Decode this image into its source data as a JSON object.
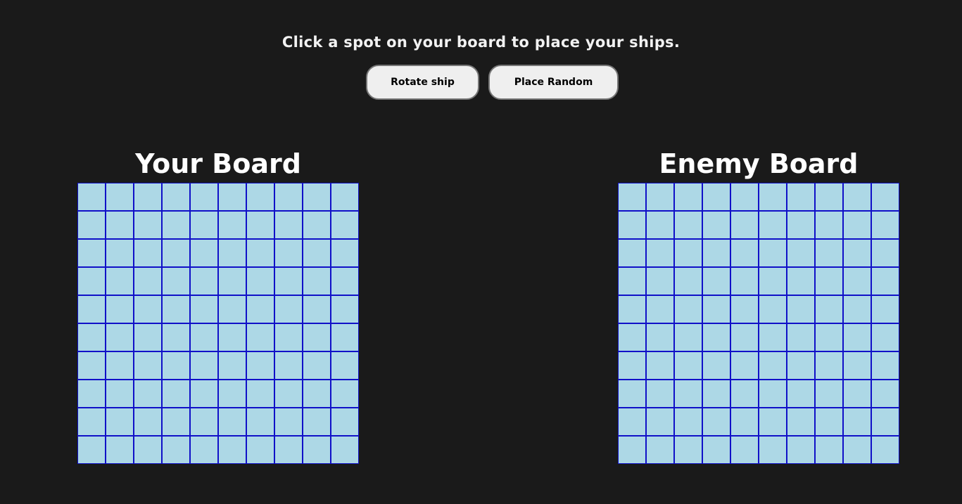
{
  "instructions": "Click a spot on your board to place your ships.",
  "controls": {
    "rotate_label": "Rotate ship",
    "random_label": "Place Random"
  },
  "boards": {
    "player": {
      "title": "Your Board",
      "rows": 10,
      "cols": 10
    },
    "enemy": {
      "title": "Enemy Board",
      "rows": 10,
      "cols": 10
    }
  },
  "colors": {
    "background": "#1a1a1a",
    "water": "#add8e6",
    "grid_line": "#1010c8",
    "button_bg": "#efefef"
  }
}
